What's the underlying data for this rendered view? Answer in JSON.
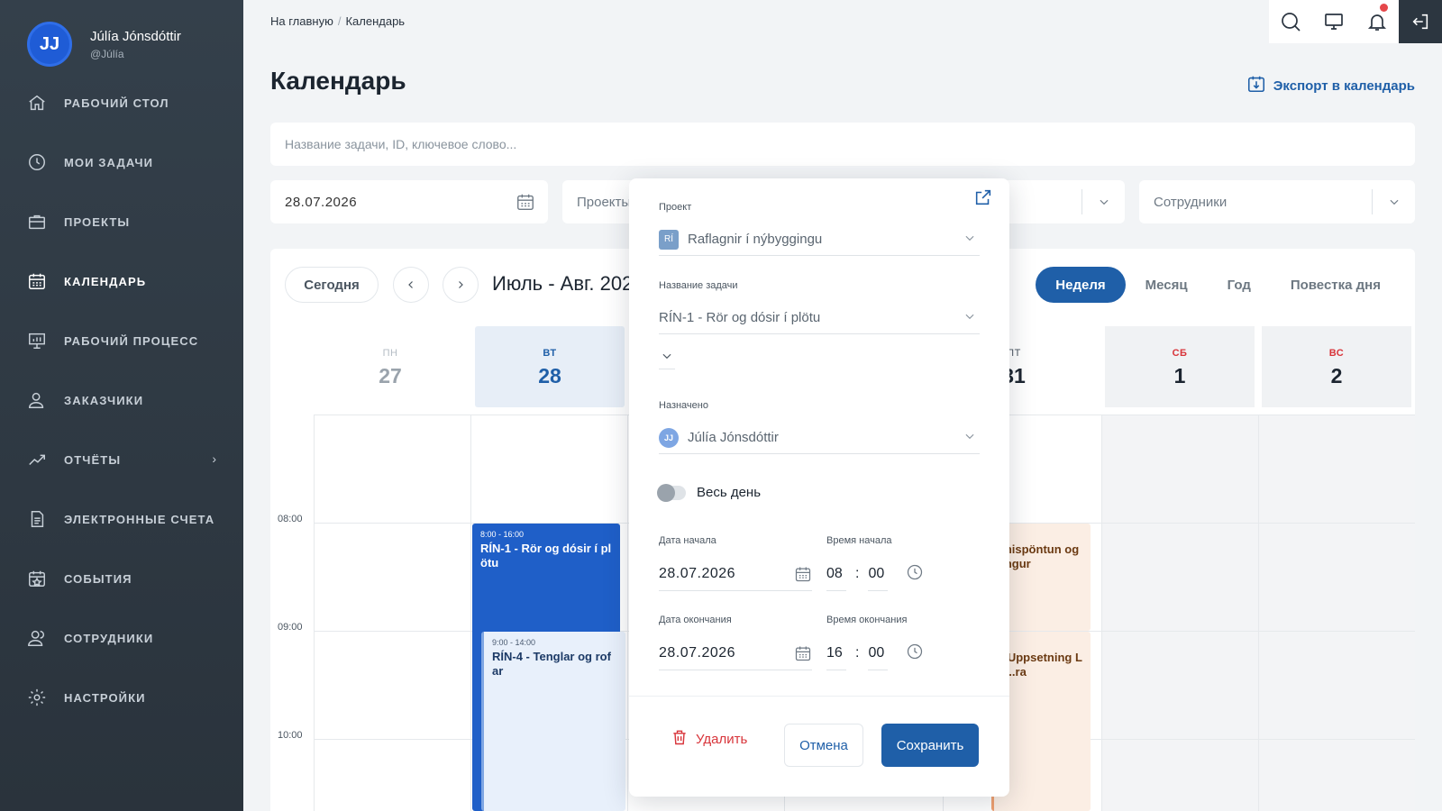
{
  "user": {
    "initials": "JJ",
    "name": "Júlía Jónsdóttir",
    "handle": "@Júlía"
  },
  "nav": [
    {
      "label": "РАБОЧИЙ СТОЛ",
      "icon": "home-icon"
    },
    {
      "label": "МОИ ЗАДАЧИ",
      "icon": "clock-icon"
    },
    {
      "label": "ПРОЕКТЫ",
      "icon": "briefcase-icon"
    },
    {
      "label": "КАЛЕНДАРЬ",
      "icon": "calendar-icon",
      "active": true
    },
    {
      "label": "РАБОЧИЙ ПРОЦЕСС",
      "icon": "presentation-icon"
    },
    {
      "label": "ЗАКАЗЧИКИ",
      "icon": "user-icon"
    },
    {
      "label": "ОТЧЁТЫ",
      "icon": "chart-icon",
      "has_children": true
    },
    {
      "label": "ЭЛЕКТРОННЫЕ СЧЕТА",
      "icon": "document-icon"
    },
    {
      "label": "СОБЫТИЯ",
      "icon": "calendar-star-icon"
    },
    {
      "label": "СОТРУДНИКИ",
      "icon": "users-icon"
    },
    {
      "label": "НАСТРОЙКИ",
      "icon": "gear-icon"
    }
  ],
  "breadcrumb": {
    "home": "На главную",
    "separator": "/",
    "current": "Календарь"
  },
  "page_title": "Календарь",
  "export_label": "Экспорт в календарь",
  "search": {
    "placeholder": "Название задачи, ID, ключевое слово..."
  },
  "filters": {
    "date": "28.07.2026",
    "projects_placeholder": "Проекты",
    "employees_placeholder": "Сотрудники"
  },
  "toolbar": {
    "today": "Сегодня",
    "range": "Июль - Авг. 2026",
    "views": [
      "Неделя",
      "Месяц",
      "Год",
      "Повестка дня"
    ],
    "active_view": "Неделя"
  },
  "days": [
    {
      "dow": "ПН",
      "num": "27"
    },
    {
      "dow": "ВТ",
      "num": "28"
    },
    {
      "dow": "ПТ",
      "num": "31"
    },
    {
      "dow": "СБ",
      "num": "1"
    },
    {
      "dow": "ВС",
      "num": "2"
    }
  ],
  "times": [
    "08:00",
    "09:00",
    "10:00"
  ],
  "events": [
    {
      "time": "8:00 - 16:00",
      "title": "RÍN-1 - Rör og dósir í plötu"
    },
    {
      "time": "9:00 - 14:00",
      "title": "RÍN-4 - Tenglar og rofar"
    },
    {
      "title": "...nispöntun og ...ngur"
    },
    {
      "title": "...Uppsetning LE...ra"
    }
  ],
  "modal": {
    "project_label": "Проект",
    "project_badge": "RÍ",
    "project_value": "Raflagnir í nýbyggingu",
    "task_label": "Название задачи",
    "task_value": "RÍN-1 - Rör og dósir í plötu",
    "assigned_label": "Назначено",
    "assigned_initials": "JJ",
    "assigned_value": "Júlía Jónsdóttir",
    "allday_label": "Весь день",
    "start_date_label": "Дата начала",
    "start_date": "28.07.2026",
    "start_time_label": "Время начала",
    "start_hour": "08",
    "start_min": "00",
    "end_date_label": "Дата окончания",
    "end_date": "28.07.2026",
    "end_time_label": "Время окончания",
    "end_hour": "16",
    "end_min": "00",
    "time_separator": ":",
    "delete_label": "Удалить",
    "cancel_label": "Отмена",
    "save_label": "Сохранить"
  },
  "colors": {
    "primary": "#1f5fa8",
    "sidebar": "#2f3943",
    "danger": "#d8343a",
    "event_blue": "#1f5fc8",
    "event_light": "#e8f0fb",
    "event_orange": "#fbeee4"
  }
}
